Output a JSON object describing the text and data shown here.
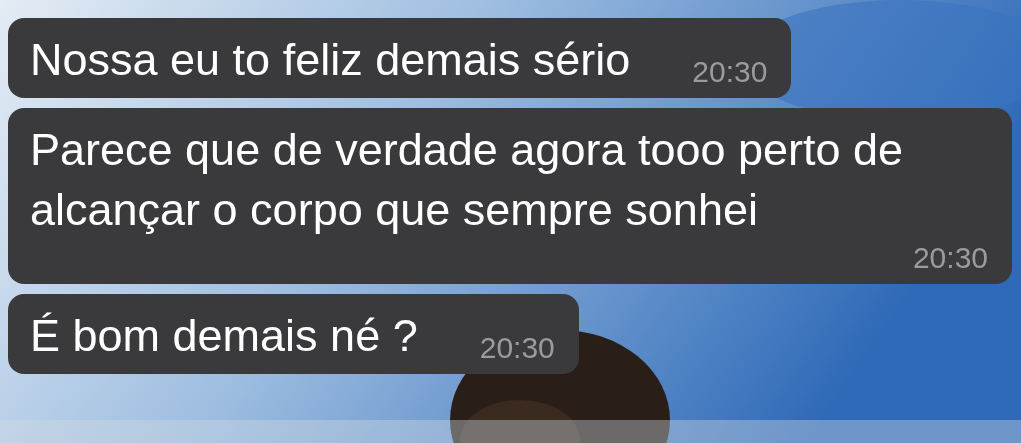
{
  "messages": [
    {
      "text": "Nossa eu to feliz demais sério",
      "time": "20:30"
    },
    {
      "text": "Parece que de verdade agora tooo perto de alcançar o corpo que sempre sonhei",
      "time": "20:30"
    },
    {
      "text": "É bom demais né ?",
      "time": "20:30"
    }
  ]
}
